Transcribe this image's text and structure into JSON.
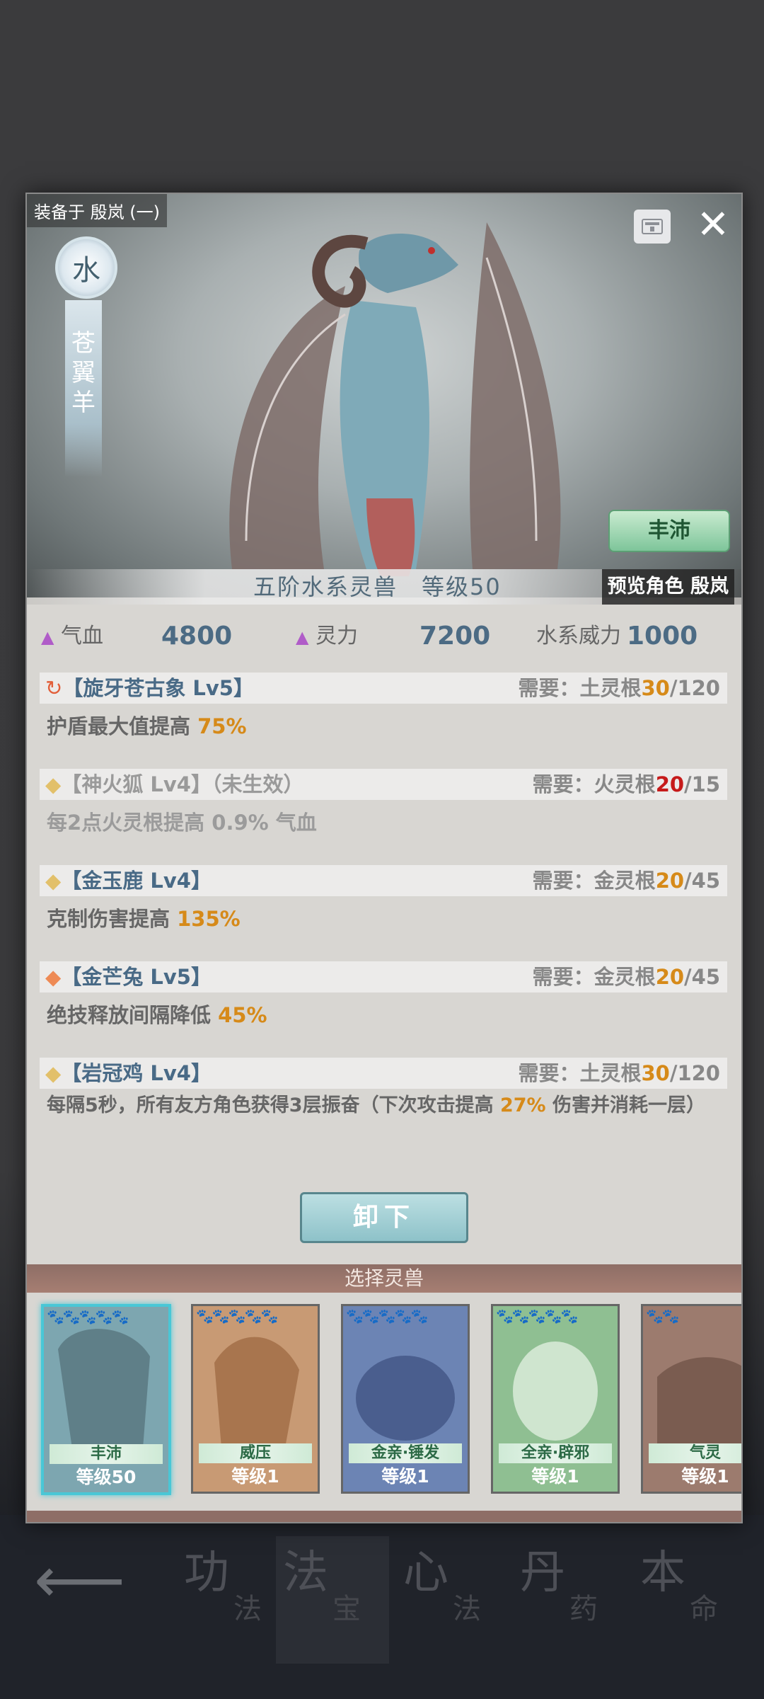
{
  "background_nav": {
    "tabs": [
      {
        "big": "功",
        "small": "法"
      },
      {
        "big": "法",
        "small": "宝"
      },
      {
        "big": "心",
        "small": "法"
      },
      {
        "big": "丹",
        "small": "药"
      },
      {
        "big": "本",
        "small": "命"
      }
    ]
  },
  "modal": {
    "equipped_label": "装备于 殷岚 (一)",
    "element": "水",
    "beast_name": "苍翼羊",
    "trait_button": "丰沛",
    "summary": "五阶水系灵兽　等级50",
    "preview_label": "预览角色 殷岚",
    "stats": {
      "hp_label": "气血",
      "hp_value": "4800",
      "mp_label": "灵力",
      "mp_value": "7200",
      "power_label": "水系威力",
      "power_value": "1000"
    },
    "skills": [
      {
        "icon": "refresh-icon",
        "title": "【旋牙苍古象 Lv5】",
        "req_label": "需要：",
        "req_root": "土灵根",
        "req_current": "30",
        "req_total": "/120",
        "desc": "护盾最大值提高 ",
        "desc_highlight": "75%",
        "desc_after": "",
        "active": true
      },
      {
        "icon": "diamond-icon",
        "title": "【神火狐 Lv4】（未生效）",
        "req_label": "需要：",
        "req_root": "火灵根",
        "req_current": "20",
        "req_total": "/15",
        "desc": "每2点火灵根提高 0.9% 气血",
        "desc_highlight": "",
        "desc_after": "",
        "active": false
      },
      {
        "icon": "diamond-icon",
        "title": "【金玉鹿 Lv4】",
        "req_label": "需要：",
        "req_root": "金灵根",
        "req_current": "20",
        "req_total": "/45",
        "desc": "克制伤害提高 ",
        "desc_highlight": "135%",
        "desc_after": "",
        "active": true
      },
      {
        "icon": "diamond-icon",
        "title": "【金芒兔 Lv5】",
        "req_label": "需要：",
        "req_root": "金灵根",
        "req_current": "20",
        "req_total": "/45",
        "desc": "绝技释放间隔降低 ",
        "desc_highlight": "45%",
        "desc_after": "",
        "active": true
      },
      {
        "icon": "diamond-icon",
        "title": "【岩冠鸡 Lv4】",
        "req_label": "需要：",
        "req_root": "土灵根",
        "req_current": "30",
        "req_total": "/120",
        "desc": "每隔5秒，所有友方角色获得3层振奋（下次攻击提高 ",
        "desc_highlight": "27%",
        "desc_after": " 伤害并消耗一层）",
        "active": true
      }
    ],
    "unequip_button": "卸下",
    "select_title": "选择灵兽",
    "beasts": [
      {
        "tag": "丰沛",
        "level": "等级50",
        "stars": "🐾🐾🐾🐾🐾",
        "color": "#7da6b0",
        "selected": true
      },
      {
        "tag": "威压",
        "level": "等级1",
        "stars": "🐾🐾🐾🐾🐾",
        "color": "#c89a74",
        "selected": false
      },
      {
        "tag": "金亲·锤发",
        "level": "等级1",
        "stars": "🐾🐾🐾🐾🐾",
        "color": "#6c84b4",
        "selected": false
      },
      {
        "tag": "全亲·辟邪",
        "level": "等级1",
        "stars": "🐾🐾🐾🐾🐾",
        "color": "#8fbf92",
        "selected": false
      },
      {
        "tag": "气灵",
        "level": "等级1",
        "stars": "🐾🐾",
        "color": "#9c7b6e",
        "selected": false
      }
    ]
  }
}
